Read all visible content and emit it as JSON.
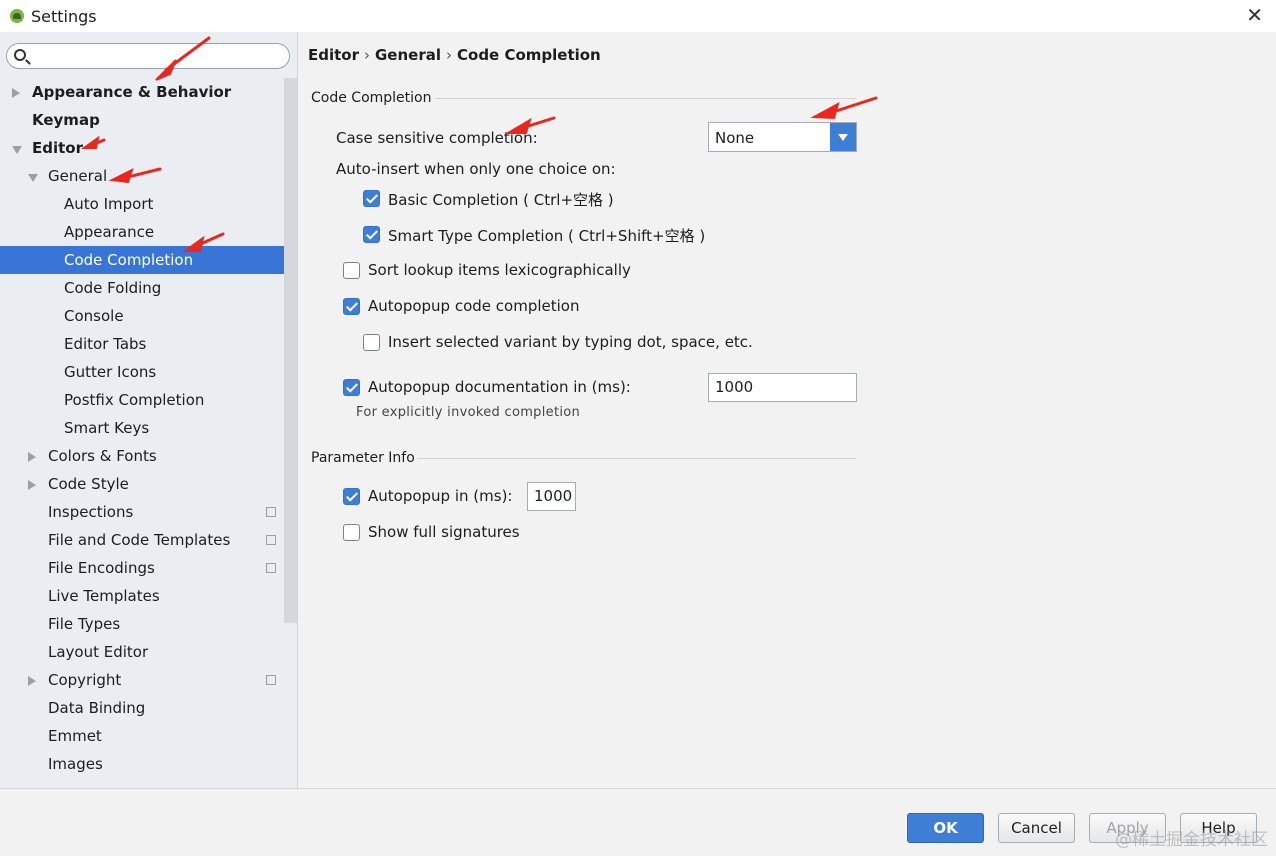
{
  "window": {
    "title": "Settings",
    "close_glyph": "✕"
  },
  "sidebar": {
    "search": {
      "value": "",
      "placeholder": ""
    },
    "items": [
      {
        "label": "Appearance & Behavior",
        "arrow": "right",
        "bold": true
      },
      {
        "label": "Keymap",
        "arrow": "",
        "bold": true
      },
      {
        "label": "Editor",
        "arrow": "down",
        "bold": true
      },
      {
        "label": "General",
        "arrow": "down"
      },
      {
        "label": "Auto Import"
      },
      {
        "label": "Appearance"
      },
      {
        "label": "Code Completion",
        "selected": true
      },
      {
        "label": "Code Folding"
      },
      {
        "label": "Console"
      },
      {
        "label": "Editor Tabs"
      },
      {
        "label": "Gutter Icons"
      },
      {
        "label": "Postfix Completion"
      },
      {
        "label": "Smart Keys"
      },
      {
        "label": "Colors & Fonts",
        "arrow": "right"
      },
      {
        "label": "Code Style",
        "arrow": "right"
      },
      {
        "label": "Inspections",
        "copy_icon": true
      },
      {
        "label": "File and Code Templates",
        "copy_icon": true
      },
      {
        "label": "File Encodings",
        "copy_icon": true
      },
      {
        "label": "Live Templates"
      },
      {
        "label": "File Types"
      },
      {
        "label": "Layout Editor"
      },
      {
        "label": "Copyright",
        "arrow": "right",
        "copy_icon": true
      },
      {
        "label": "Data Binding"
      },
      {
        "label": "Emmet"
      },
      {
        "label": "Images"
      }
    ]
  },
  "main": {
    "breadcrumb": [
      "Editor",
      "General",
      "Code Completion"
    ],
    "breadcrumb_separator": "›",
    "code_completion_group": {
      "title": "Code Completion",
      "case_sensitive_label": "Case sensitive completion:",
      "case_sensitive_value": "None",
      "auto_insert_label": "Auto-insert when only one choice on:",
      "basic_completion": {
        "label": "Basic Completion ( Ctrl+空格 )",
        "checked": true
      },
      "smart_type_completion": {
        "label": "Smart Type Completion ( Ctrl+Shift+空格 )",
        "checked": true
      },
      "sort_lookup": {
        "label": "Sort lookup items lexicographically",
        "checked": false
      },
      "autopopup_code": {
        "label": "Autopopup code completion",
        "checked": true
      },
      "insert_selected_variant": {
        "label": "Insert selected variant by typing dot, space, etc.",
        "checked": false
      },
      "autopopup_docs": {
        "label": "Autopopup documentation in (ms):",
        "checked": true,
        "value": "1000"
      },
      "docs_note": "For explicitly invoked completion"
    },
    "parameter_info_group": {
      "title": "Parameter Info",
      "autopopup": {
        "label": "Autopopup in (ms):",
        "checked": true,
        "value": "1000"
      },
      "show_full_signatures": {
        "label": "Show full signatures",
        "checked": false
      }
    }
  },
  "footer": {
    "ok_label": "OK",
    "cancel_label": "Cancel",
    "apply_label": "Apply",
    "help_label": "Help"
  },
  "watermark": "@稀土掘金技术社区",
  "colors": {
    "accent": "#3e7ed6",
    "selection": "#3875d7",
    "annotation": "#e8281f"
  }
}
